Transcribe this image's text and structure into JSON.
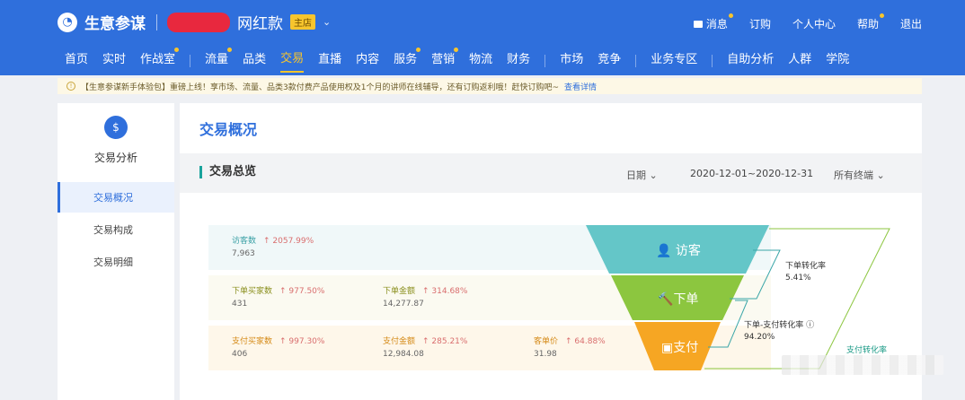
{
  "app": {
    "name": "生意参谋",
    "shop_suffix": "网红款",
    "shop_badge": "主店"
  },
  "top_links": [
    "消息",
    "订购",
    "个人中心",
    "帮助",
    "退出"
  ],
  "nav": [
    {
      "label": "首页"
    },
    {
      "label": "实时"
    },
    {
      "label": "作战室"
    },
    {
      "label": "流量"
    },
    {
      "label": "品类"
    },
    {
      "label": "交易",
      "active": true
    },
    {
      "label": "直播"
    },
    {
      "label": "内容"
    },
    {
      "label": "服务"
    },
    {
      "label": "营销"
    },
    {
      "label": "物流"
    },
    {
      "label": "财务"
    },
    {
      "label": "市场"
    },
    {
      "label": "竞争"
    },
    {
      "label": "业务专区"
    },
    {
      "label": "自助分析"
    },
    {
      "label": "人群"
    },
    {
      "label": "学院"
    }
  ],
  "notice": {
    "text": "【生意参谋新手体验包】重磅上线！享市场、流量、品类3款付费产品使用权及1个月的讲师在线辅导，还有订购返利哦！赶快订购吧~",
    "link": "查看详情"
  },
  "sidebar": {
    "title": "交易分析",
    "items": [
      "交易概况",
      "交易构成",
      "交易明细"
    ]
  },
  "main": {
    "title": "交易概况",
    "section_title": "交易总览",
    "date_label": "日期",
    "date_range": "2020-12-01~2020-12-31",
    "terminal": "所有终端"
  },
  "metrics": {
    "visitors": {
      "name": "访客数",
      "change": "2057.99%",
      "value": "7,963"
    },
    "order_buyers": {
      "name": "下单买家数",
      "change": "977.50%",
      "value": "431"
    },
    "order_amount": {
      "name": "下单金额",
      "change": "314.68%",
      "value": "14,277.87"
    },
    "pay_buyers": {
      "name": "支付买家数",
      "change": "997.30%",
      "value": "406"
    },
    "pay_amount": {
      "name": "支付金额",
      "change": "285.21%",
      "value": "12,984.08"
    },
    "unit_price": {
      "name": "客单价",
      "change": "64.88%",
      "value": "31.98"
    }
  },
  "funnel": {
    "stage1": "访客",
    "stage2": "下单",
    "stage3": "支付",
    "conv_order": {
      "name": "下单转化率",
      "value": "5.41%"
    },
    "conv_order_pay": {
      "name": "下单-支付转化率",
      "value": "94.20%"
    },
    "conv_pay": {
      "name": "支付转化率"
    }
  },
  "colors": {
    "brand": "#2f6fdc",
    "funnel_top": "#64c6c8",
    "funnel_mid": "#8cc63f",
    "funnel_bottom": "#f6a623"
  }
}
